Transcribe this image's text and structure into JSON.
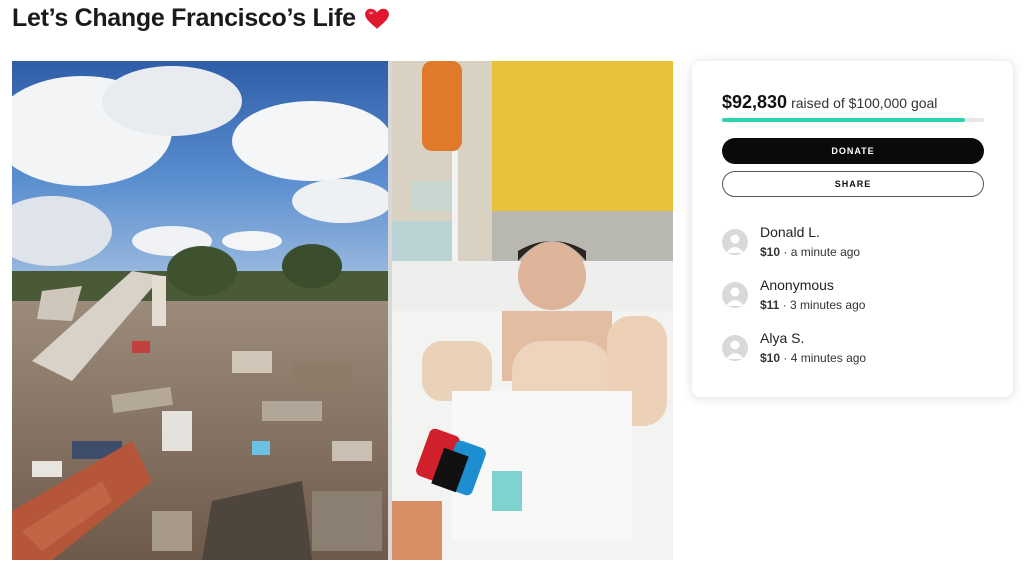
{
  "page": {
    "title": "Let’s Change Francisco’s Life",
    "title_emoji_icon": "red-heart-icon"
  },
  "campaign": {
    "raised_amount": "$92,830",
    "raised_text": "raised of $100,000 goal",
    "progress_fraction": 0.9283,
    "progress_color": "#2bd4b0",
    "donate_label": "DONATE",
    "share_label": "SHARE"
  },
  "donations": [
    {
      "name": "Donald L.",
      "amount": "$10",
      "time": "a minute ago"
    },
    {
      "name": "Anonymous",
      "amount": "$11",
      "time": "3 minutes ago"
    },
    {
      "name": "Alya S.",
      "amount": "$10",
      "time": "4 minutes ago"
    }
  ],
  "colors": {
    "accent": "#2bd4b0",
    "button_dark": "#0a0a0a",
    "heart": "#e0182d"
  }
}
